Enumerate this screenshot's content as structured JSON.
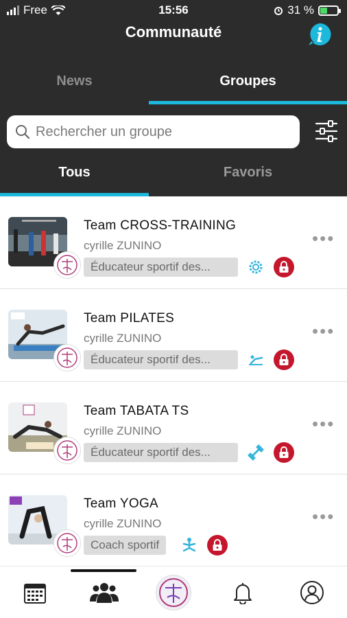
{
  "status_bar": {
    "carrier": "Free",
    "time": "15:56",
    "battery": "31 %"
  },
  "header": {
    "title": "Communauté",
    "info_icon": "info-icon"
  },
  "tabs_top": [
    {
      "label": "News",
      "active": false
    },
    {
      "label": "Groupes",
      "active": true
    }
  ],
  "search": {
    "placeholder": "Rechercher un groupe",
    "value": ""
  },
  "tabs_sub": [
    {
      "label": "Tous",
      "active": true
    },
    {
      "label": "Favoris",
      "active": false
    }
  ],
  "groups": [
    {
      "name": "Team CROSS-TRAINING",
      "owner": "cyrille  ZUNINO",
      "role": "Éducateur sportif des...",
      "sport_icon": "gear-sport-icon",
      "locked": true
    },
    {
      "name": "Team PILATES",
      "owner": "cyrille  ZUNINO",
      "role": "Éducateur sportif des...",
      "sport_icon": "pilates-icon",
      "locked": true
    },
    {
      "name": "Team TABATA TS",
      "owner": "cyrille  ZUNINO",
      "role": "Éducateur sportif des...",
      "sport_icon": "dumbbell-icon",
      "locked": true
    },
    {
      "name": "Team YOGA",
      "owner": "cyrille  ZUNINO",
      "role": "Coach sportif",
      "sport_icon": "yoga-icon",
      "locked": true
    }
  ],
  "bottom_nav": [
    {
      "icon": "calendar-icon"
    },
    {
      "icon": "community-icon",
      "active": true
    },
    {
      "icon": "app-logo"
    },
    {
      "icon": "bell-icon"
    },
    {
      "icon": "profile-icon"
    }
  ],
  "colors": {
    "header_bg": "#2c2c2c",
    "accent": "#1db9dc",
    "lock_red": "#c4172d"
  }
}
